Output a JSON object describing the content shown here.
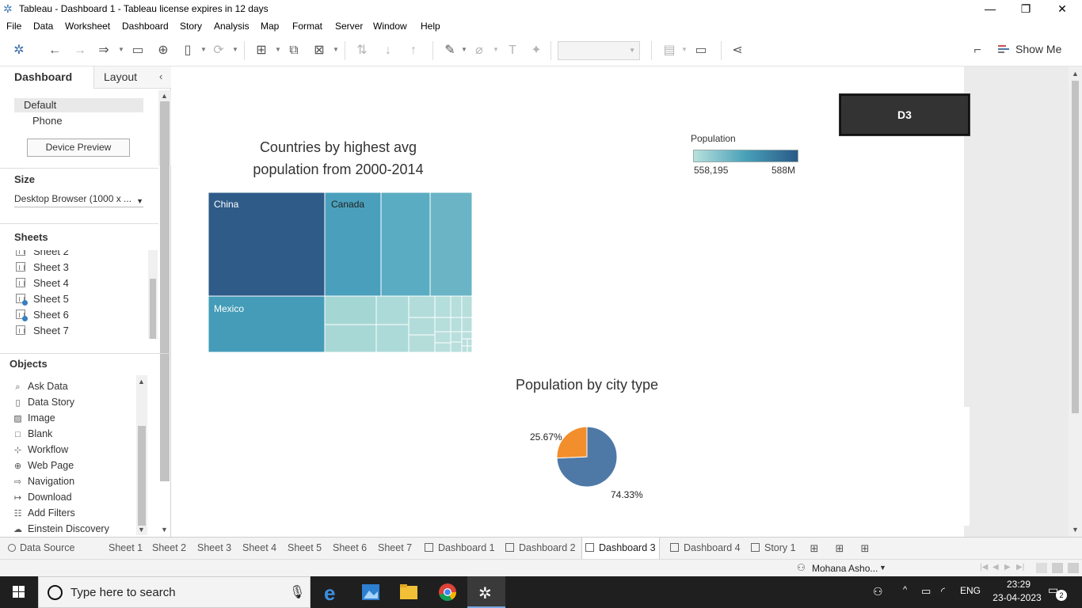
{
  "window": {
    "title": "Tableau - Dashboard 1 - Tableau license expires in 12 days",
    "minimize": "—",
    "maximize": "❐",
    "close": "✕"
  },
  "menu": [
    "File",
    "Data",
    "Worksheet",
    "Dashboard",
    "Story",
    "Analysis",
    "Map",
    "Format",
    "Server",
    "Window",
    "Help"
  ],
  "toolbar": {
    "show_me": "Show Me"
  },
  "left_pane": {
    "tabs": [
      "Dashboard",
      "Layout"
    ],
    "devices": [
      "Default",
      "Phone"
    ],
    "device_preview": "Device Preview",
    "size_heading": "Size",
    "size_value": "Desktop Browser (1000 x ...",
    "sheets_heading": "Sheets",
    "sheets": [
      "Sheet 2",
      "Sheet 3",
      "Sheet 4",
      "Sheet 5",
      "Sheet 6",
      "Sheet 7"
    ],
    "objects_heading": "Objects",
    "objects": [
      {
        "label": "Ask Data",
        "icon": "ask-data-icon"
      },
      {
        "label": "Data Story",
        "icon": "data-story-icon"
      },
      {
        "label": "Image",
        "icon": "image-icon"
      },
      {
        "label": "Blank",
        "icon": "blank-icon"
      },
      {
        "label": "Workflow",
        "icon": "workflow-icon"
      },
      {
        "label": "Web Page",
        "icon": "globe-icon"
      },
      {
        "label": "Navigation",
        "icon": "navigation-icon"
      },
      {
        "label": "Download",
        "icon": "download-icon"
      },
      {
        "label": "Add Filters",
        "icon": "filter-icon"
      },
      {
        "label": "Einstein Discovery",
        "icon": "einstein-icon"
      }
    ]
  },
  "dashboard": {
    "d3_button": "D3",
    "treemap": {
      "title_line1": "Countries by highest avg",
      "title_line2": "population from 2000-2014",
      "labels": {
        "china": "China",
        "canada": "Canada",
        "mexico": "Mexico"
      }
    },
    "legend": {
      "title": "Population",
      "min": "558,195",
      "max": "588M",
      "colors": [
        "#b8e0dc",
        "#48a0b8",
        "#2a5a88"
      ]
    },
    "pie": {
      "title": "Population by city type",
      "label_small": "25.67%",
      "label_large": "74.33%"
    }
  },
  "chart_data": {
    "type": "pie",
    "title": "Population by city type",
    "slices": [
      {
        "value": 74.33,
        "label": "74.33%",
        "color": "#4e79a7"
      },
      {
        "value": 25.67,
        "label": "25.67%",
        "color": "#f28e2b"
      }
    ]
  },
  "tabs": [
    {
      "label": "Data Source",
      "kind": "datasource"
    },
    {
      "label": "Sheet 1",
      "kind": "sheet"
    },
    {
      "label": "Sheet 2",
      "kind": "sheet"
    },
    {
      "label": "Sheet 3",
      "kind": "sheet"
    },
    {
      "label": "Sheet 4",
      "kind": "sheet"
    },
    {
      "label": "Sheet 5",
      "kind": "sheet"
    },
    {
      "label": "Sheet 6",
      "kind": "sheet"
    },
    {
      "label": "Sheet 7",
      "kind": "sheet"
    },
    {
      "label": "Dashboard 1",
      "kind": "dashboard"
    },
    {
      "label": "Dashboard 2",
      "kind": "dashboard"
    },
    {
      "label": "Dashboard 3",
      "kind": "dashboard",
      "active": true
    },
    {
      "label": "Dashboard 4",
      "kind": "dashboard"
    },
    {
      "label": "Story 1",
      "kind": "story"
    }
  ],
  "status": {
    "user": "Mohana Asho..."
  },
  "taskbar": {
    "search_placeholder": "Type here to search",
    "language": "ENG",
    "time": "23:29",
    "date": "23-04-2023",
    "notifications": "2"
  }
}
